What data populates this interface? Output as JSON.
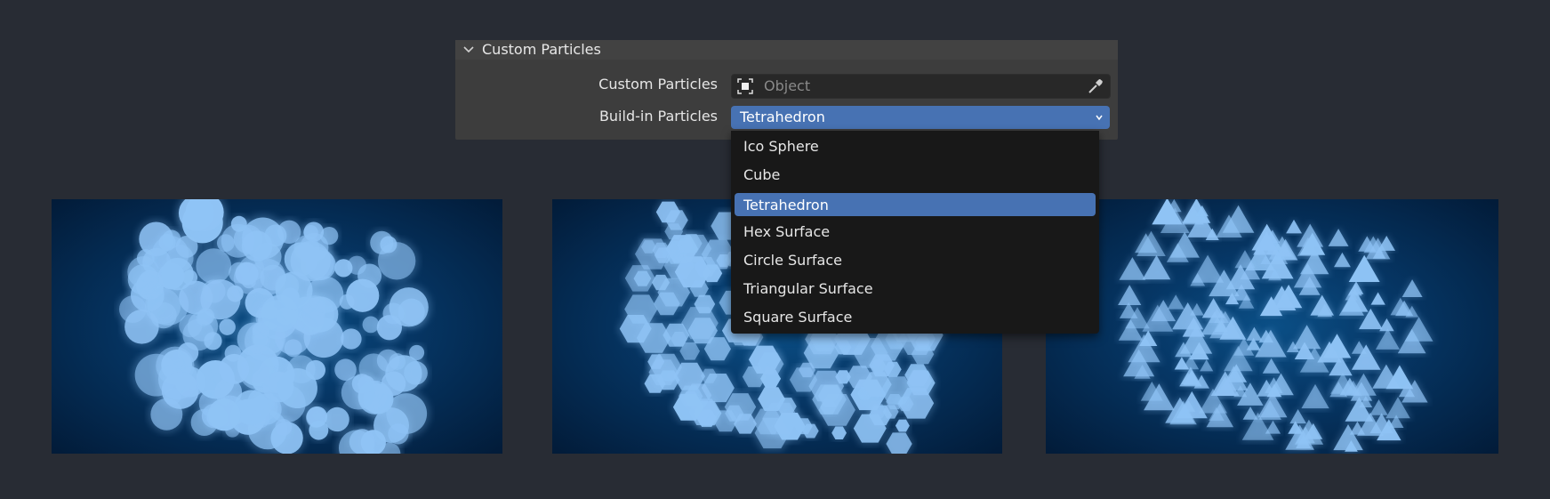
{
  "panel": {
    "title": "Custom Particles",
    "custom_particles_label": "Custom Particles",
    "object_placeholder": "Object",
    "buildin_label": "Build-in Particles",
    "selected": "Tetrahedron"
  },
  "dropdown": {
    "items": [
      {
        "label": "Ico Sphere",
        "active": false
      },
      {
        "label": "Cube",
        "active": false
      },
      {
        "label": "Tetrahedron",
        "active": true
      },
      {
        "label": "Hex Surface",
        "active": false
      },
      {
        "label": "Circle Surface",
        "active": false
      },
      {
        "label": "Triangular Surface",
        "active": false
      },
      {
        "label": "Square Surface",
        "active": false
      }
    ]
  },
  "renders": [
    {
      "name": "render-ico-sphere",
      "shape": "circle"
    },
    {
      "name": "render-hex-surface",
      "shape": "hex"
    },
    {
      "name": "render-tetrahedron",
      "shape": "triangle"
    }
  ],
  "colors": {
    "background": "#282c34",
    "panel": "#3d3d3d",
    "accent": "#4772b3",
    "menu": "#181818",
    "particle": "#8fc3f5"
  }
}
